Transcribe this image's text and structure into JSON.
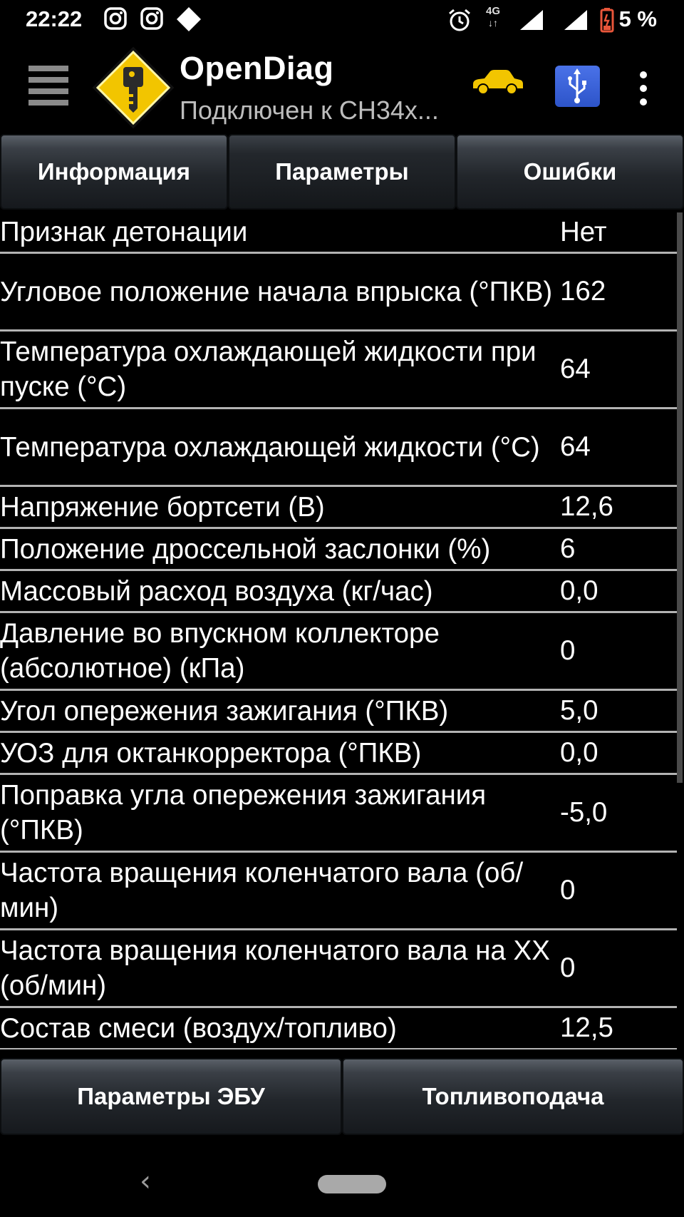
{
  "status_bar": {
    "time": "22:22",
    "network": "4G",
    "battery": "5 %",
    "icons": [
      "instagram-icon",
      "instagram-icon",
      "diamond-notification-icon",
      "alarm-icon",
      "signal-icon",
      "signal-icon",
      "battery-low-icon"
    ]
  },
  "app_bar": {
    "title": "OpenDiag",
    "subtitle": "Подключен к CH34x...",
    "icons": [
      "menu-icon",
      "opendiag-logo",
      "car-icon",
      "usb-icon",
      "overflow-menu-icon"
    ],
    "accent_yellow": "#f2c500",
    "usb_blue": "#3a62dc"
  },
  "tabs": [
    {
      "label": "Информация",
      "active": false
    },
    {
      "label": "Параметры",
      "active": true
    },
    {
      "label": "Ошибки",
      "active": false
    }
  ],
  "params": [
    {
      "label": "Признак детонации",
      "value": "Нет"
    },
    {
      "label": "Угловое положение начала впрыска (°ПКВ)",
      "value": "162"
    },
    {
      "label": "Температура охлаждающей жидкости при пуске (°С)",
      "value": "64"
    },
    {
      "label": "Температура охлаждающей жидкости (°С)",
      "value": "64"
    },
    {
      "label": "Напряжение бортсети (В)",
      "value": "12,6"
    },
    {
      "label": "Положение дроссельной заслонки (%)",
      "value": "6"
    },
    {
      "label": "Массовый расход воздуха (кг/час)",
      "value": "0,0"
    },
    {
      "label": "Давление во впускном коллекторе (абсолютное) (кПа)",
      "value": "0"
    },
    {
      "label": "Угол опережения зажигания (°ПКВ)",
      "value": "5,0"
    },
    {
      "label": "УОЗ для октанкорректора (°ПКВ)",
      "value": "0,0"
    },
    {
      "label": "Поправка угла опережения зажигания (°ПКВ)",
      "value": "-5,0"
    },
    {
      "label": "Частота вращения коленчатого вала (об/мин)",
      "value": "0"
    },
    {
      "label": "Частота вращения коленчатого вала на ХХ (об/мин)",
      "value": "0"
    },
    {
      "label": "Состав смеси (воздух/топливо)",
      "value": "12,5"
    }
  ],
  "bottom_tabs": [
    {
      "label": "Параметры ЭБУ"
    },
    {
      "label": "Топливоподача"
    }
  ]
}
